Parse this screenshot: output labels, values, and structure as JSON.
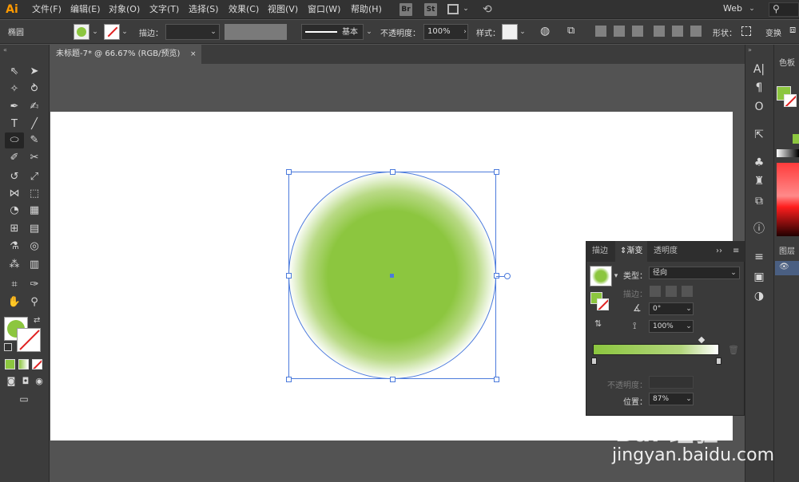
{
  "app": {
    "logo": "Ai",
    "accent": "#ff9a00"
  },
  "menu": [
    "文件(F)",
    "编辑(E)",
    "对象(O)",
    "文字(T)",
    "选择(S)",
    "效果(C)",
    "视图(V)",
    "窗口(W)",
    "帮助(H)"
  ],
  "app_buttons": [
    "Br",
    "St"
  ],
  "workspace": {
    "label": "Web"
  },
  "controlbar": {
    "tool_name": "椭圆",
    "stroke_label": "描边：",
    "brush_label": "基本",
    "opacity_label": "不透明度：",
    "opacity_value": "100%",
    "style_label": "样式：",
    "shape_label": "形状：",
    "transform_label": "变换"
  },
  "document": {
    "tab_title": "未标题-7* @ 66.67% (RGB/预览)",
    "close_glyph": "×"
  },
  "gradient_panel": {
    "tabs": [
      "描边",
      "渐变",
      "透明度"
    ],
    "active_tab": "渐变",
    "type_label": "类型：",
    "type_value": "径向",
    "stroke_label": "描边：",
    "angle_value": "0°",
    "aspect_value": "100%",
    "opacity_label": "不透明度：",
    "position_label": "位置：",
    "position_value": "87%",
    "colors": {
      "start": "#8cc63f",
      "end": "#ffffff"
    }
  },
  "right_panels": {
    "swatch_tab": "色板",
    "layers_tab": "图层"
  },
  "fill_color": "#8cc63f",
  "selection_color": "#4c7bdc",
  "watermark": {
    "logo": "Bai 经验",
    "url": "jingyan.baidu.com"
  }
}
